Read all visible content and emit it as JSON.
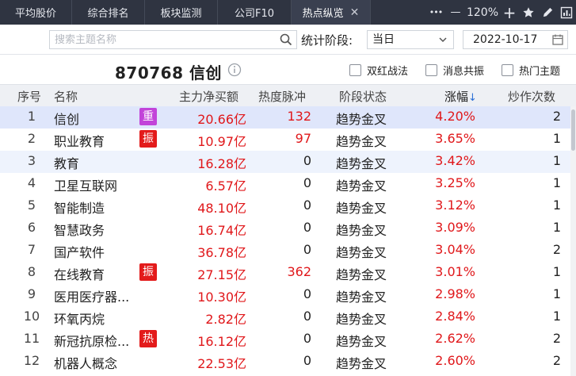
{
  "tabs": [
    {
      "label": "平均股价",
      "active": false
    },
    {
      "label": "综合排名",
      "active": false
    },
    {
      "label": "板块监测",
      "active": false
    },
    {
      "label": "公司F10",
      "active": false
    },
    {
      "label": "热点纵览",
      "active": true
    }
  ],
  "tab_close": "✕",
  "window_tools": {
    "more": "•••",
    "zoom_out": "—",
    "zoom_level": "120%",
    "zoom_in": "+"
  },
  "filter": {
    "search_placeholder": "搜索主题名称",
    "stage_label": "统计阶段:",
    "stage_value": "当日",
    "date_value": "2022-10-17"
  },
  "header": {
    "title": "870768 信创",
    "checkboxes": [
      {
        "label": "双红战法",
        "checked": false
      },
      {
        "label": "消息共振",
        "checked": false
      },
      {
        "label": "热门主题",
        "checked": false
      }
    ]
  },
  "table": {
    "columns": {
      "idx": "序号",
      "name": "名称",
      "flow": "主力净买额",
      "heat": "热度脉冲",
      "stage": "阶段状态",
      "pct": "涨幅",
      "pct_sort": "↓",
      "count": "炒作次数"
    },
    "rows": [
      {
        "idx": "1",
        "name": "信创",
        "tag": "重",
        "tag_type": "zhong",
        "flow": "20.66亿",
        "heat": "132",
        "stage": "趋势金叉",
        "pct": "4.20%",
        "count": "2"
      },
      {
        "idx": "2",
        "name": "职业教育",
        "tag": "振",
        "tag_type": "zhen",
        "flow": "10.97亿",
        "heat": "97",
        "stage": "趋势金叉",
        "pct": "3.65%",
        "count": "1"
      },
      {
        "idx": "3",
        "name": "教育",
        "tag": "",
        "tag_type": "",
        "flow": "16.28亿",
        "heat": "0",
        "stage": "趋势金叉",
        "pct": "3.42%",
        "count": "1"
      },
      {
        "idx": "4",
        "name": "卫星互联网",
        "tag": "",
        "tag_type": "",
        "flow": "6.57亿",
        "heat": "0",
        "stage": "趋势金叉",
        "pct": "3.25%",
        "count": "1"
      },
      {
        "idx": "5",
        "name": "智能制造",
        "tag": "",
        "tag_type": "",
        "flow": "48.10亿",
        "heat": "0",
        "stage": "趋势金叉",
        "pct": "3.12%",
        "count": "1"
      },
      {
        "idx": "6",
        "name": "智慧政务",
        "tag": "",
        "tag_type": "",
        "flow": "16.74亿",
        "heat": "0",
        "stage": "趋势金叉",
        "pct": "3.09%",
        "count": "1"
      },
      {
        "idx": "7",
        "name": "国产软件",
        "tag": "",
        "tag_type": "",
        "flow": "36.78亿",
        "heat": "0",
        "stage": "趋势金叉",
        "pct": "3.04%",
        "count": "2"
      },
      {
        "idx": "8",
        "name": "在线教育",
        "tag": "振",
        "tag_type": "zhen",
        "flow": "27.15亿",
        "heat": "362",
        "stage": "趋势金叉",
        "pct": "3.01%",
        "count": "1"
      },
      {
        "idx": "9",
        "name": "医用医疗器...",
        "tag": "",
        "tag_type": "",
        "flow": "10.30亿",
        "heat": "0",
        "stage": "趋势金叉",
        "pct": "2.98%",
        "count": "1"
      },
      {
        "idx": "10",
        "name": "环氧丙烷",
        "tag": "",
        "tag_type": "",
        "flow": "2.82亿",
        "heat": "0",
        "stage": "趋势金叉",
        "pct": "2.84%",
        "count": "1"
      },
      {
        "idx": "11",
        "name": "新冠抗原检...",
        "tag": "热",
        "tag_type": "re",
        "flow": "16.12亿",
        "heat": "0",
        "stage": "趋势金叉",
        "pct": "2.62%",
        "count": "2"
      },
      {
        "idx": "12",
        "name": "机器人概念",
        "tag": "",
        "tag_type": "",
        "flow": "22.53亿",
        "heat": "0",
        "stage": "趋势金叉",
        "pct": "2.60%",
        "count": "2"
      }
    ]
  },
  "colors": {
    "rise_red": "#e0171a",
    "tag_purple": "#c244d9",
    "selected_row": "#dfe6fb",
    "tabbar_bg": "#2f3441"
  }
}
